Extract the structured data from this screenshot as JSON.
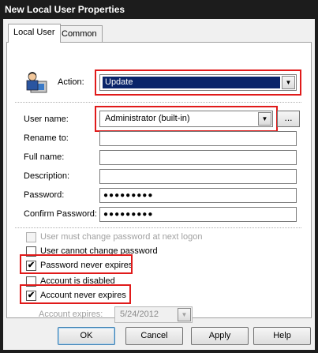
{
  "window": {
    "title": "New Local User Properties"
  },
  "tabs": [
    {
      "label": "Local User",
      "active": true
    },
    {
      "label": "Common",
      "active": false
    }
  ],
  "action": {
    "label": "Action:",
    "value": "Update",
    "icon": "user-computer-icon"
  },
  "user_name": {
    "label": "User name:",
    "value": "Administrator (built-in)",
    "browse_label": "..."
  },
  "fields": {
    "rename_to": {
      "label": "Rename to:",
      "value": ""
    },
    "full_name": {
      "label": "Full name:",
      "value": ""
    },
    "description": {
      "label": "Description:",
      "value": ""
    },
    "password": {
      "label": "Password:",
      "value": "●●●●●●●●●"
    },
    "confirm_password": {
      "label": "Confirm Password:",
      "value": "●●●●●●●●●"
    }
  },
  "checkboxes": {
    "must_change": {
      "label": "User must change password at next logon",
      "checked": false,
      "enabled": false
    },
    "cannot_change": {
      "label": "User cannot change password",
      "checked": false,
      "enabled": true
    },
    "never_expires": {
      "label": "Password never expires",
      "checked": true,
      "enabled": true
    },
    "disabled": {
      "label": "Account is disabled",
      "checked": false,
      "enabled": true
    },
    "account_never_expires": {
      "label": "Account never expires",
      "checked": true,
      "enabled": true
    }
  },
  "account_expires": {
    "label": "Account expires:",
    "value": "5/24/2012",
    "enabled": false
  },
  "checkmark": "✔",
  "buttons": {
    "ok": "OK",
    "cancel": "Cancel",
    "apply": "Apply",
    "help": "Help"
  },
  "colors": {
    "highlight": "#e01a1a",
    "selection": "#0a246a"
  }
}
